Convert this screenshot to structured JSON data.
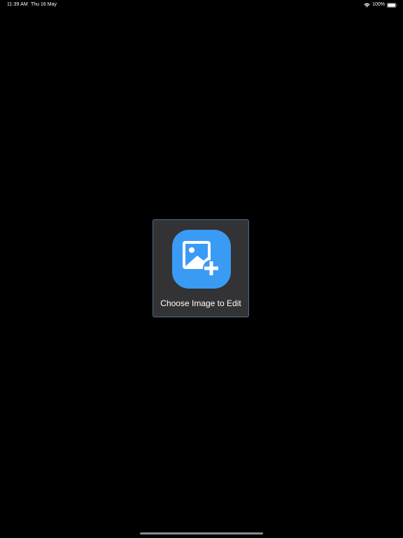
{
  "status_bar": {
    "time": "11:39 AM",
    "date": "Thu 16 May",
    "wifi_icon": "wifi-icon",
    "battery_percent": "100%",
    "battery_icon": "battery-full-icon"
  },
  "main": {
    "choose_label": "Choose Image to Edit",
    "icon": "image-add-icon",
    "accent_color": "#3a9bf5",
    "card_color": "#333335",
    "card_border_color": "#4a6f8e",
    "background_color": "#000000"
  },
  "home_indicator": {
    "color": "#8a8a8e"
  }
}
